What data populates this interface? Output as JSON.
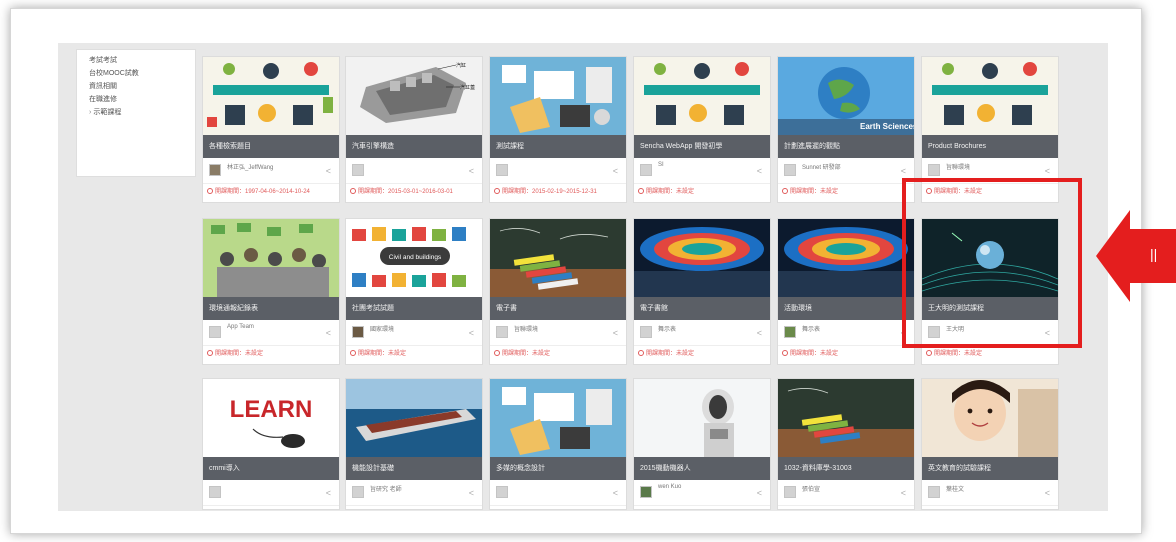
{
  "sidebar": {
    "items": [
      "考試考試",
      "台校MOOC試教",
      "資訊相關",
      "在職進修",
      "示範課程"
    ]
  },
  "cards": [
    {
      "title": "各種檢索題目",
      "author": "林正弘_JeffWang",
      "period": "開課期間：1997-04-06~2014-10-24"
    },
    {
      "title": "汽車引擎構造",
      "author": "",
      "period": "開課期間：2015-03-01~2016-03-01"
    },
    {
      "title": "測試課程",
      "author": "",
      "period": "開課期間：2015-02-19~2015-12-31"
    },
    {
      "title": "Sencha WebApp 開發初學",
      "author": "SI",
      "period": "開課期間：未設定"
    },
    {
      "title": "計劃進展遲的觀點",
      "author": "Sunnet 研發部",
      "period": "開課期間：未設定"
    },
    {
      "title": "Product Brochures",
      "author": "旨聯環境",
      "period": "開課期間：未設定"
    },
    {
      "title": "環境通報紀錄表",
      "author": "App Team",
      "period": "開課期間：未設定"
    },
    {
      "title": "社團考試試題",
      "author": "國家環境",
      "period": "開課期間：未設定"
    },
    {
      "title": "電子書",
      "author": "旨聯環境",
      "period": "開課期間：未設定"
    },
    {
      "title": "電子書館",
      "author": "舞示表",
      "period": "開課期間：未設定"
    },
    {
      "title": "活動環境",
      "author": "舞示表",
      "period": "開課期間：未設定"
    },
    {
      "title": "王大明的測試課程",
      "author": "王大明",
      "period": "開課期間：未設定"
    },
    {
      "title": "cmmi導入",
      "author": "",
      "period": ""
    },
    {
      "title": "機能設計基礎",
      "author": "旨研究 老師",
      "period": ""
    },
    {
      "title": "多媒的概念設計",
      "author": "",
      "period": ""
    },
    {
      "title": "2015機動機器人",
      "author": "wen Kuo",
      "period": ""
    },
    {
      "title": "1032-資料庫學-31003",
      "author": "張伯宣",
      "period": ""
    },
    {
      "title": "英文教育的試驗課程",
      "author": "葉桂文",
      "period": ""
    }
  ],
  "thumb_text": {
    "civil": "Civil and buildings",
    "earth": "Earth Sciences",
    "learn": "LEARN",
    "engine_label_1": "汽缸",
    "engine_label_2": "汽缸蓋"
  },
  "arrow_label": "||",
  "colors": {
    "highlight": "#e41e1e",
    "caption_bg": "#5b5f66"
  }
}
